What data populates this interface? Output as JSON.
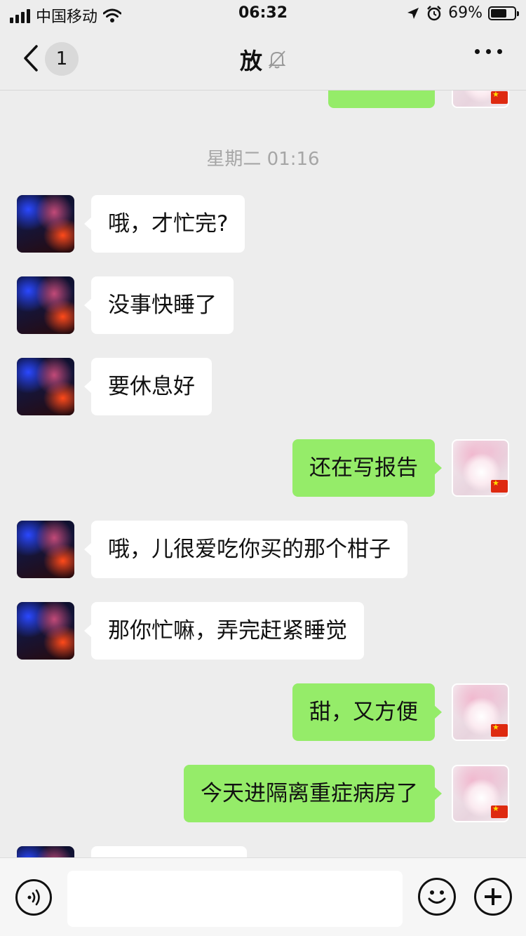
{
  "status_bar": {
    "carrier": "中国移动",
    "time": "06:32",
    "battery_text": "69%",
    "battery_level": 0.69
  },
  "nav": {
    "unread_count": "1",
    "title": "放",
    "muted": true
  },
  "time_separator": "星期二 01:16",
  "messages": [
    {
      "side": "out",
      "text": "",
      "partial": true
    },
    {
      "side": "in",
      "text": "哦，才忙完?"
    },
    {
      "side": "in",
      "text": "没事快睡了"
    },
    {
      "side": "in",
      "text": "要休息好"
    },
    {
      "side": "out",
      "text": "还在写报告"
    },
    {
      "side": "in",
      "text": "哦，儿很爱吃你买的那个柑子"
    },
    {
      "side": "in",
      "text": "那你忙嘛，弄完赶紧睡觉"
    },
    {
      "side": "out",
      "text": "甜，又方便"
    },
    {
      "side": "out",
      "text": "今天进隔离重症病房了"
    },
    {
      "side": "in",
      "text": "",
      "partial": true
    }
  ],
  "input": {
    "placeholder": ""
  },
  "colors": {
    "background": "#ededed",
    "incoming_bubble": "#ffffff",
    "outgoing_bubble": "#95ec69",
    "timestamp": "#a6a6a6"
  },
  "icons": {
    "back": "chevron-left-icon",
    "mute": "bell-muted-icon",
    "more": "more-dots-icon",
    "voice": "voice-icon",
    "emoji": "emoji-icon",
    "plus": "plus-icon"
  }
}
